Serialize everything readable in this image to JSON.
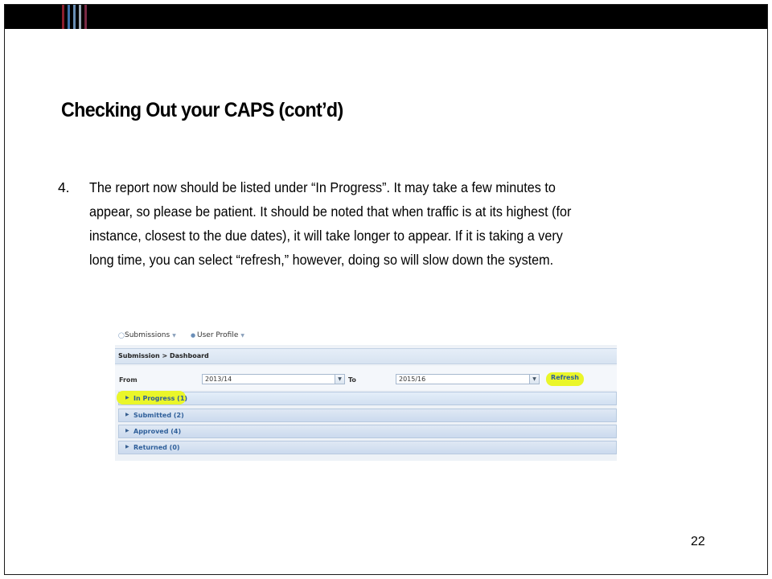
{
  "slide": {
    "title": "Checking Out your CAPS (cont’d)",
    "item_number": "4.",
    "paragraph_lines": [
      "The report now should be listed under “In Progress”.  It may take a few minutes to",
      "appear, so please be patient.  It should be noted that when traffic is at its highest (for",
      "instance, closest to the due dates), it will take longer to appear.  If it is taking a very",
      "long time, you can select “refresh,” however, doing so will slow down the system."
    ],
    "page_number": "22",
    "stripe_colors": [
      "#8b1d2c",
      "#3d6fa8",
      "#6a8fb6",
      "#9aa8b8",
      "#7a2a44"
    ]
  },
  "screenshot": {
    "menu": {
      "submissions": "Submissions",
      "user_profile": "User Profile"
    },
    "breadcrumb": "Submission > Dashboard",
    "filter": {
      "from_label": "From",
      "from_value": "2013/14",
      "to_label": "To",
      "to_value": "2015/16",
      "refresh_label": "Refresh"
    },
    "accordion": [
      "In Progress (1)",
      "Submitted (2)",
      "Approved (4)",
      "Returned (0)"
    ],
    "highlight_color": "#eaf62a"
  }
}
